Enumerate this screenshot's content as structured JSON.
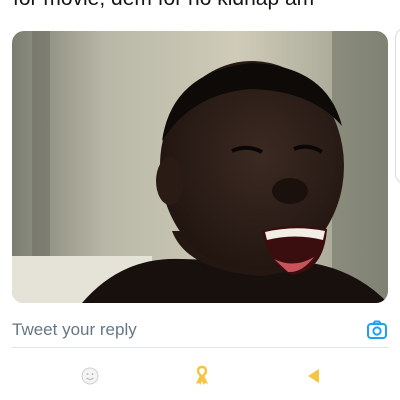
{
  "tweet": {
    "text": "for movie, dem for no kidnap am",
    "media": {
      "subject": "laughing-man-photo"
    }
  },
  "reply": {
    "placeholder": "Tweet your reply",
    "icon": "camera-icon",
    "accent": "#1da1f2"
  },
  "bottom_nav": [
    {
      "icon": "emoji-icon"
    },
    {
      "icon": "ribbon-icon",
      "color": "#f5c542"
    },
    {
      "icon": "back-arrow-icon",
      "color": "#f5c542"
    }
  ]
}
